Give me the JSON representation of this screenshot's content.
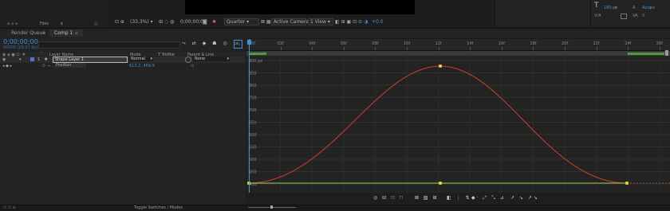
{
  "project": {
    "files_label": "Files"
  },
  "viewer": {
    "zoom": "(33.3%)",
    "timecode": "0;00;00;00",
    "resolution": "Quarter",
    "camera": "Active Camera",
    "views": "1 View",
    "exposure": "+0.0"
  },
  "character": {
    "size": "180 px",
    "auto": "Auto",
    "px": "px",
    "zero": "0"
  },
  "tabs": {
    "render_queue": "Render Queue",
    "comp": "Comp 1"
  },
  "timeline": {
    "timecode": "0;00;00;00",
    "sub_timecode": "00000 (29.97 fps)",
    "search_placeholder": "ρ·",
    "columns": {
      "layer_name": "Layer Name",
      "mode": "Mode",
      "trkmat": "T TrkMat",
      "parent": "Parent & Link"
    },
    "layer": {
      "number": "1",
      "name": "Shape Layer 1",
      "mode": "Normal",
      "parent": "None"
    },
    "property": {
      "name": "Position",
      "value": "613.2, 409.9"
    },
    "toggle_label": "Toggle Switches / Modes"
  },
  "ruler": {
    "ticks": [
      "00f",
      "02f",
      "04f",
      "06f",
      "08f",
      "10f",
      "12f",
      "14f",
      "16f",
      "18f",
      "20f",
      "22f",
      "24f",
      "26f"
    ]
  },
  "graph": {
    "y_labels": [
      "900 px",
      "850",
      "800",
      "750",
      "700",
      "650",
      "600",
      "550",
      "500",
      "450",
      "400"
    ]
  },
  "colors": {
    "curve": "#d23b2e",
    "flat": "#8fd14f",
    "keyframe": "#f0e040",
    "accent": "#3f8fda"
  }
}
